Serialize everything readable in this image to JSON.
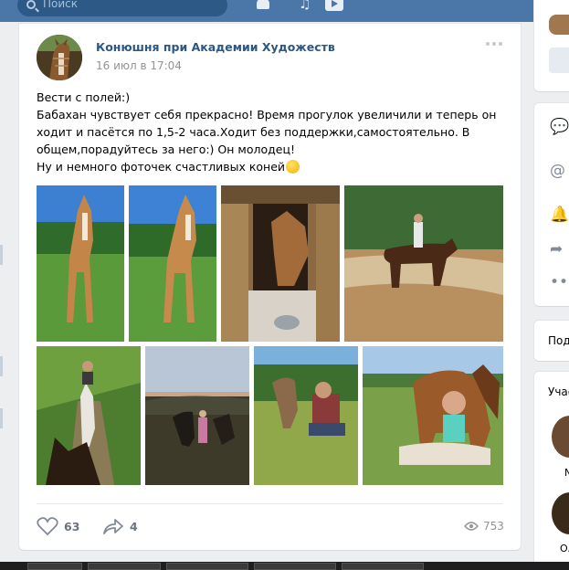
{
  "header": {
    "search_placeholder": "Поиск",
    "icons": [
      "search-icon",
      "bell-icon",
      "music-icon",
      "play-icon"
    ]
  },
  "post": {
    "author": "Конюшня при Академии Художеств",
    "date": "16 июл в 17:04",
    "lines": [
      "Вести с полей:)",
      "Бабахан чувствует себя прекрасно! Время прогулок увеличили и теперь он ходит и пасётся по 1,5-2 часа.Ходит без поддержки,самостоятельно. В общем,порадуйтесь за него:) Он молодец!",
      "Ну и немного фоточек счастливых коней"
    ],
    "emoji": "smiling-face-icon",
    "photos_count_row1": 4,
    "photos_count_row2": 4,
    "likes": "63",
    "shares": "4",
    "views": "753"
  },
  "right": {
    "section_label_1": "Под",
    "section_label_2": "Учас",
    "person_1": "N",
    "person_2": "O."
  },
  "colors": {
    "header": "#4a76a8",
    "link": "#2a5885",
    "background": "#edeef0"
  }
}
